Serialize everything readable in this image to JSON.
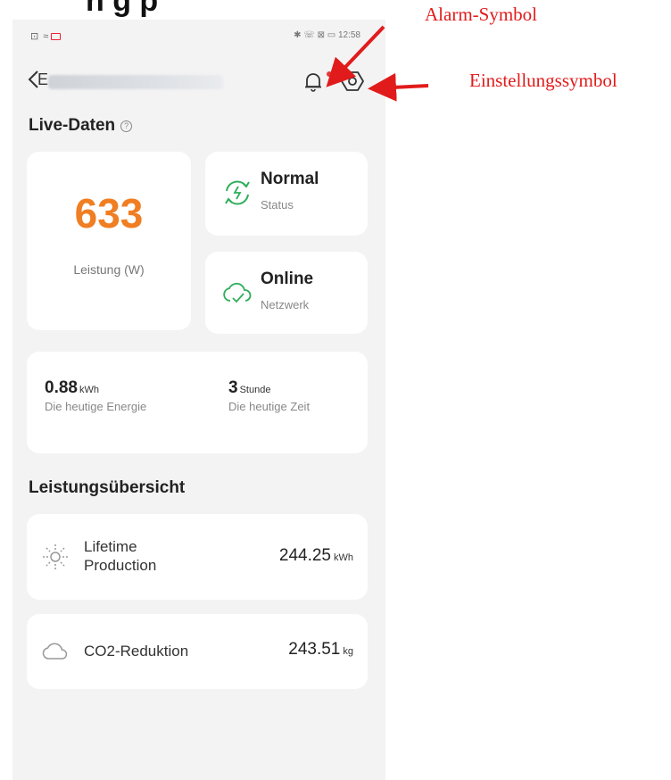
{
  "page_heading_fragment": "n g   p",
  "status_bar": {
    "left": "⊡ ≈",
    "right": "✱ ☏ ⊠ ▭ 12:58"
  },
  "topbar": {
    "back_label": "E",
    "icons": [
      "chevron-left-icon",
      "bell-icon",
      "settings-hexagon-icon"
    ]
  },
  "live": {
    "title": "Live-Daten",
    "help_glyph": "?",
    "power_value": "633",
    "power_label": "Leistung (W)",
    "status_value": "Normal",
    "status_label": "Status",
    "network_value": "Online",
    "network_label": "Netzwerk",
    "energy_value": "0.88",
    "energy_unit": "kWh",
    "energy_label": "Die heutige Energie",
    "time_value": "3",
    "time_unit": "Stunde",
    "time_label": "Die heutige Zeit"
  },
  "overview": {
    "title": "Leistungsübersicht",
    "lifetime_label": "Lifetime Production",
    "lifetime_value": "244.25",
    "lifetime_unit": "kWh",
    "co2_label": "CO2-Reduktion",
    "co2_value": "243.51",
    "co2_unit": "kg"
  },
  "annotations": {
    "alarm": "Alarm-Symbol",
    "settings": "Einstellungssymbol"
  },
  "colors": {
    "accent_orange": "#f07e22",
    "status_green": "#2fae5b",
    "annotation_red": "#e11b1b"
  }
}
